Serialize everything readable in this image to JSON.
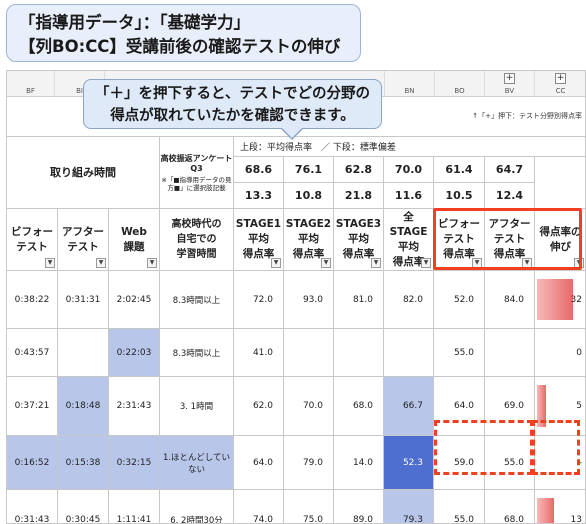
{
  "title": {
    "line1": "「指導用データ」：「基礎学力」",
    "line2": "【列BO:CC】受講前後の確認テストの伸び"
  },
  "callout": {
    "line1": "「＋」を押下すると、テストでどの分野の",
    "line2": "得点が取れていたかを確認できます。"
  },
  "sheet": {
    "columns": [
      "BF",
      "BI",
      "BN",
      "BO",
      "BV",
      "CC"
    ],
    "plus_label": "+",
    "plus_note": "↑「+」押下：テスト分野別得点率",
    "header": {
      "effort_time": "取り組み時間",
      "survey_title": "高校振返アンケート\nQ3",
      "survey_note": "※「■指導用データの見方■」に選択肢記載",
      "row_legend": "上段：平均得点率　／ 下段：標準偏差",
      "avg_row": [
        "68.6",
        "76.1",
        "62.8",
        "70.0",
        "61.4",
        "64.7"
      ],
      "sd_row": [
        "13.3",
        "10.8",
        "21.8",
        "11.6",
        "10.5",
        "12.4"
      ],
      "cols": [
        "ビフォー\nテスト",
        "アフター\nテスト",
        "Web\n課題",
        "高校時代の\n自宅での\n学習時間",
        "STAGE1\n平均\n得点率",
        "STAGE2\n平均\n得点率",
        "STAGE3\n平均\n得点率",
        "全\nSTAGE\n平均\n得点率",
        "ビフォー\nテスト\n得点率",
        "アフター\nテスト\n得点率",
        "得点率の\n伸び"
      ]
    },
    "rows": [
      [
        "0:38:22",
        "0:31:31",
        "2:02:45",
        "8.3時間以上",
        "72.0",
        "93.0",
        "81.0",
        "82.0",
        "52.0",
        "84.0",
        "32"
      ],
      [
        "0:43:57",
        "",
        "0:22:03",
        "8.3時間以上",
        "41.0",
        "",
        "",
        "",
        "55.0",
        "",
        "0"
      ],
      [
        "0:37:21",
        "0:18:48",
        "2:31:43",
        "3. 1時間",
        "62.0",
        "70.0",
        "68.0",
        "66.7",
        "64.0",
        "69.0",
        "5"
      ],
      [
        "0:16:52",
        "0:15:38",
        "0:32:15",
        "1.ほとんどしていない",
        "64.0",
        "79.0",
        "14.0",
        "52.3",
        "59.0",
        "55.0",
        "-"
      ],
      [
        "0:31:43",
        "0:30:45",
        "1:11:41",
        "6. 2時間30分",
        "74.0",
        "75.0",
        "89.0",
        "79.3",
        "55.0",
        "68.0",
        "13"
      ]
    ],
    "growth_bars": [
      0.8,
      0,
      0.13,
      0,
      0.32
    ],
    "colors": {
      "highlight_dark": "#4e6fcf",
      "highlight_light": "#b8c6ea",
      "red_frame": "#f0401e"
    }
  }
}
